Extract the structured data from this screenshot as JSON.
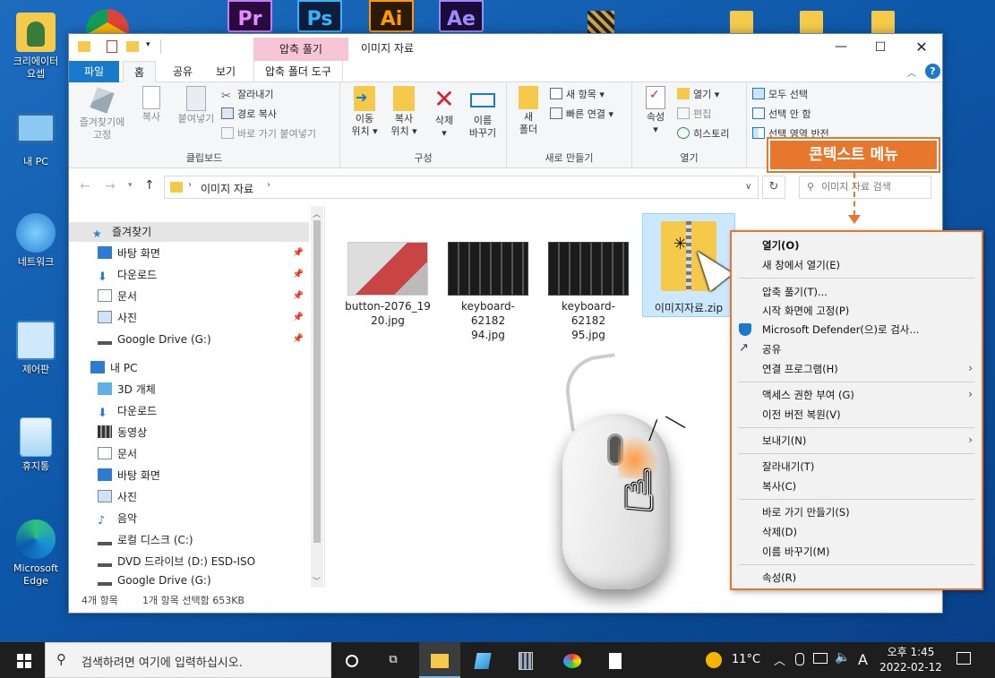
{
  "desktop": {
    "icons": [
      {
        "label": "크리에이터\n요셉",
        "color": "#3d8ed6"
      },
      {
        "label": "내 PC",
        "color": "#5aa6e6"
      },
      {
        "label": "네트워크",
        "color": "#4a9be0"
      },
      {
        "label": "제어판",
        "color": "#6fb3ea"
      },
      {
        "label": "휴지통",
        "color": "#7fc1f0"
      },
      {
        "label": "Microsoft\nEdge",
        "color": "#1aa0a8"
      }
    ],
    "top_apps": [
      {
        "label": "Pr",
        "color": "#2a0b3d",
        "fg": "#e98cff"
      },
      {
        "label": "Ps",
        "color": "#0c1e3a",
        "fg": "#35b4ff"
      },
      {
        "label": "Ai",
        "color": "#2d1a05",
        "fg": "#ff9a00"
      },
      {
        "label": "Ae",
        "color": "#1c0b3a",
        "fg": "#9a8cff"
      }
    ]
  },
  "window": {
    "title": "이미지 자료",
    "context_tab_header": "압축 풀기",
    "context_tab": "압축 폴더 도구",
    "tabs": [
      "파일",
      "홈",
      "공유",
      "보기"
    ],
    "ribbon": {
      "clipboard": {
        "label": "클립보드",
        "pin": "즐겨찾기에\n고정",
        "copy": "복사",
        "paste": "붙여넣기",
        "cut": "잘라내기",
        "copy_path": "경로 복사",
        "paste_shortcut": "바로 가기 붙여넣기"
      },
      "organize": {
        "label": "구성",
        "move": "이동\n위치 ▾",
        "copyto": "복사\n위치 ▾",
        "delete": "삭제\n▾",
        "rename": "이름\n바꾸기"
      },
      "new": {
        "label": "새로 만들기",
        "new_folder": "새\n폴더",
        "new_item": "새 항목 ▾",
        "quick_access": "빠른 연결 ▾"
      },
      "open": {
        "label": "열기",
        "properties": "속성\n▾",
        "open": "열기 ▾",
        "edit": "편집",
        "history": "히스토리"
      },
      "select": {
        "select_all": "모두 선택",
        "select_none": "선택 안 함",
        "invert": "선택 영역 반전"
      }
    },
    "address": {
      "path": "이미지 자료",
      "search_placeholder": "이미지 자료 검색"
    },
    "nav": {
      "quick_access": "즐겨찾기",
      "quick_items": [
        "바탕 화면",
        "다운로드",
        "문서",
        "사진",
        "Google Drive (G:)"
      ],
      "this_pc": "내 PC",
      "pc_items": [
        "3D 개체",
        "다운로드",
        "동영상",
        "문서",
        "바탕 화면",
        "사진",
        "음악",
        "로컬 디스크 (C:)",
        "DVD 드라이브 (D:) ESD-ISO",
        "Google Drive (G:)"
      ]
    },
    "files": [
      {
        "name": "button-2076_1920.jpg",
        "line1": "button-2076_19",
        "line2": "20.jpg"
      },
      {
        "name": "keyboard-6218294.jpg",
        "line1": "keyboard-62182",
        "line2": "94.jpg"
      },
      {
        "name": "keyboard-6218295.jpg",
        "line1": "keyboard-62182",
        "line2": "95.jpg"
      },
      {
        "name": "이미지자료.zip",
        "line1": "이미지자료.zip",
        "line2": ""
      }
    ],
    "status": {
      "count": "4개 항목",
      "selected": "1개 항목 선택함 653KB"
    }
  },
  "callout": {
    "label": "콘텍스트 메뉴",
    "color": "#e8772e"
  },
  "context_menu": [
    "열기(O)",
    "새 창에서 열기(E)",
    "압축 풀기(T)...",
    "시작 화면에 고정(P)",
    "Microsoft Defender(으)로 검사...",
    "공유",
    "연결 프로그램(H)",
    "액세스 권한 부여 (G)",
    "이전 버전 복원(V)",
    "보내기(N)",
    "잘라내기(T)",
    "복사(C)",
    "바로 가기 만들기(S)",
    "삭제(D)",
    "이름 바꾸기(M)",
    "속성(R)"
  ],
  "taskbar": {
    "search_placeholder": "검색하려면 여기에 입력하십시오.",
    "weather": "11°C",
    "ime": "A",
    "time": "오후 1:45",
    "date": "2022-02-12"
  }
}
